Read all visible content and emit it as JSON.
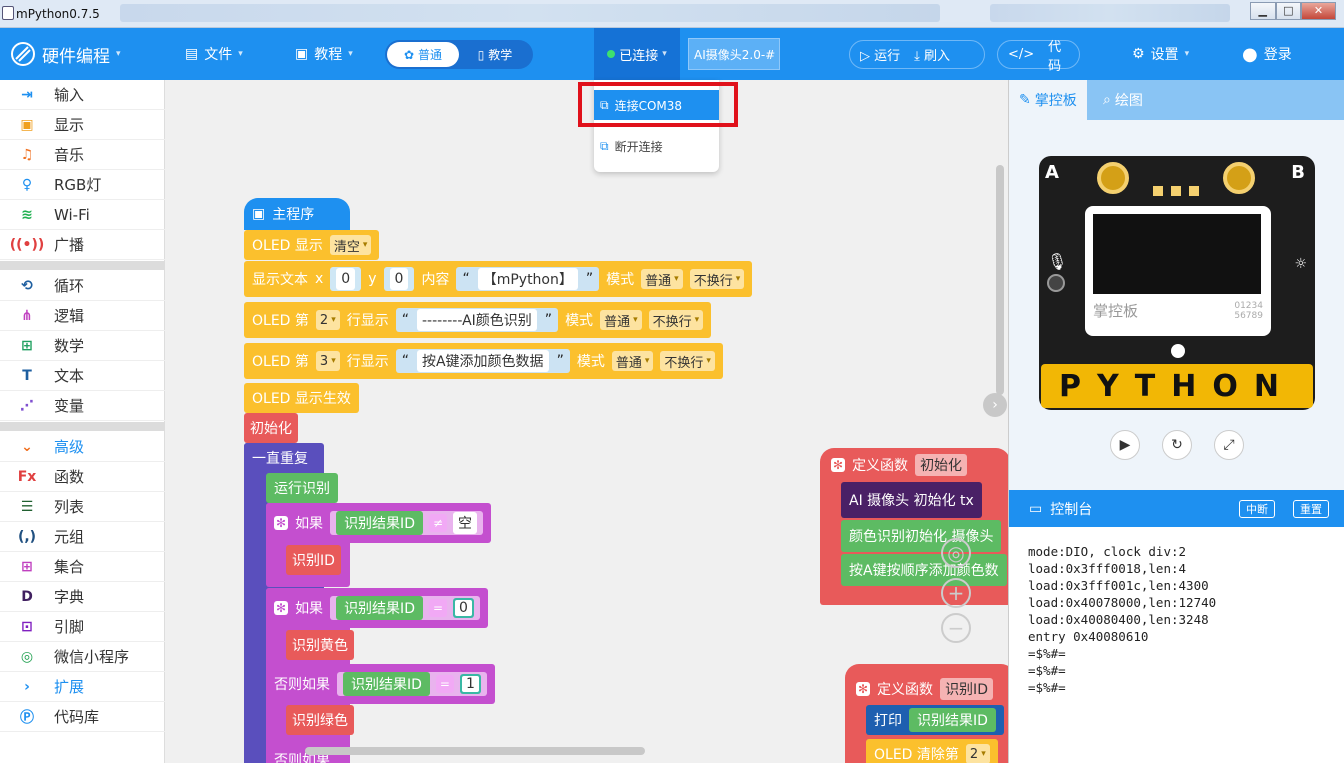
{
  "window": {
    "title": "mPython0.7.5",
    "min": "▁",
    "max": "□",
    "close": "✕"
  },
  "nav": {
    "brand": "硬件编程",
    "file": "文件",
    "tutorial": "教程",
    "mode_normal": "普通",
    "mode_teach": "教学",
    "connection_status": "已连接",
    "camera_select": "AI摄像头2.0-#",
    "run": "运行",
    "flash": "刷入",
    "code": "代码",
    "settings": "设置",
    "login": "登录"
  },
  "connection_menu": {
    "connect": "连接COM38",
    "disconnect": "断开连接"
  },
  "sidebar": {
    "items": [
      {
        "label": "输入",
        "icon": "input-icon",
        "color": "#1e90f0"
      },
      {
        "label": "显示",
        "icon": "display-icon",
        "color": "#f0a020"
      },
      {
        "label": "音乐",
        "icon": "music-icon",
        "color": "#f07020"
      },
      {
        "label": "RGB灯",
        "icon": "bulb-icon",
        "color": "#1e90f0"
      },
      {
        "label": "Wi-Fi",
        "icon": "wifi-icon",
        "color": "#20b050"
      },
      {
        "label": "广播",
        "icon": "broadcast-icon",
        "color": "#e04040"
      },
      {
        "label": "循环",
        "icon": "loop-icon",
        "color": "#1e5fa0"
      },
      {
        "label": "逻辑",
        "icon": "logic-icon",
        "color": "#c040c0"
      },
      {
        "label": "数学",
        "icon": "math-icon",
        "color": "#20a060"
      },
      {
        "label": "文本",
        "icon": "text-icon",
        "color": "#1e5fa0"
      },
      {
        "label": "变量",
        "icon": "variable-icon",
        "color": "#8050d0"
      },
      {
        "label": "高级",
        "icon": "chevron-down-icon",
        "color": "#f07020"
      },
      {
        "label": "函数",
        "icon": "function-icon",
        "color": "#e04040"
      },
      {
        "label": "列表",
        "icon": "list-icon",
        "color": "#206030"
      },
      {
        "label": "元组",
        "icon": "tuple-icon",
        "color": "#205080"
      },
      {
        "label": "集合",
        "icon": "set-icon",
        "color": "#c040c0"
      },
      {
        "label": "字典",
        "icon": "dict-icon",
        "color": "#402060"
      },
      {
        "label": "引脚",
        "icon": "pin-icon",
        "color": "#8020c0"
      },
      {
        "label": "微信小程序",
        "icon": "wechat-icon",
        "color": "#20a050"
      },
      {
        "label": "扩展",
        "icon": "chevron-right-icon",
        "color": "#1e90f0"
      },
      {
        "label": "代码库",
        "icon": "code-library-icon",
        "color": "#1e90f0"
      }
    ]
  },
  "blocks": {
    "main": "主程序",
    "oled_show": "OLED 显示",
    "clear": "清空",
    "show_text": "显示文本",
    "x": "x",
    "x_val": "0",
    "y": "y",
    "y_val": "0",
    "content": "内容",
    "text1": "【mPython】",
    "mode": "模式",
    "normal": "普通",
    "no_wrap": "不换行",
    "oled_line": "OLED 第",
    "line2": "2",
    "line_show": "行显示",
    "text2": "--------AI颜色识别",
    "line3": "3",
    "text3": "按A键添加颜色数据",
    "oled_apply": "OLED 显示生效",
    "init": "初始化",
    "forever": "一直重复",
    "run_recog": "运行识别",
    "if": "如果",
    "recog_result_id": "识别结果ID",
    "neq": "≠",
    "empty": "空",
    "recog_id": "识别ID",
    "eq": "=",
    "zero": "0",
    "recog_yellow": "识别黄色",
    "else_if": "否则如果",
    "one": "1",
    "recog_green": "识别绿色",
    "else_if2": "否则如果",
    "def_func": "定义函数",
    "func_init": "初始化",
    "ai_cam_init": "AI 摄像头 初始化 tx",
    "color_init": "颜色识别初始化 摄像头",
    "press_a": "按A键按顺序添加颜色数",
    "def_func2": "定义函数",
    "func_recog_id": "识别ID",
    "print": "打印",
    "print_arg": "识别结果ID",
    "oled_clear_line": "OLED 清除第",
    "clear_line_val": "2"
  },
  "panel": {
    "tab_control": "掌控板",
    "tab_draw": "绘图",
    "board_label_a": "A",
    "board_label_b": "B",
    "board_logo": "掌控板",
    "board_code": "01234\n56789",
    "board_brand": "PYTHON",
    "console_title": "控制台",
    "interrupt": "中断",
    "reset": "重置",
    "console_lines": [
      "mode:DIO, clock div:2",
      "load:0x3fff0018,len:4",
      "load:0x3fff001c,len:4300",
      "load:0x40078000,len:12740",
      "load:0x40080400,len:3248",
      "entry 0x40080610",
      "=$%#=",
      "=$%#=",
      "=$%#="
    ]
  },
  "colors": {
    "accent": "#1e90f0",
    "highlight": "#e0111b",
    "block_yellow": "#fbc02d",
    "block_magenta": "#c44fcf"
  }
}
